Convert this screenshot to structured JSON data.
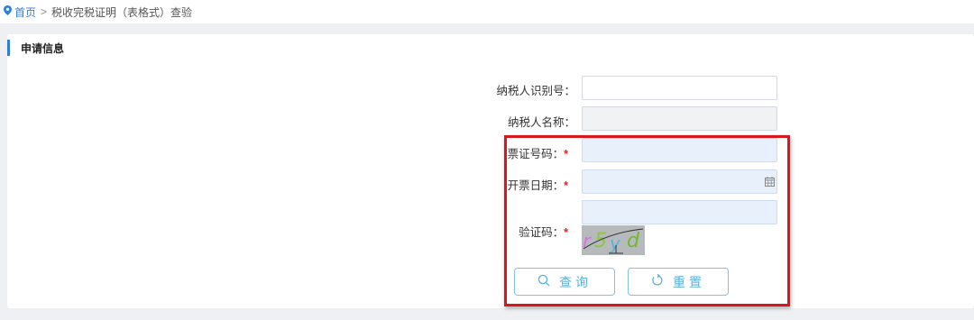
{
  "breadcrumb": {
    "home": "首页",
    "separator": ">",
    "current": "税收完税证明（表格式）查验"
  },
  "panel": {
    "title": "申请信息"
  },
  "form": {
    "taxpayer_id": {
      "label": "纳税人识别号：",
      "value": ""
    },
    "taxpayer_name": {
      "label": "纳税人名称：",
      "value": ""
    },
    "ticket_number": {
      "label": "票证号码：",
      "required_mark": "*",
      "value": ""
    },
    "issue_date": {
      "label": "开票日期：",
      "required_mark": "*",
      "value": "",
      "icon": "calendar-icon"
    },
    "captcha": {
      "label": "验证码：",
      "required_mark": "*",
      "value": "",
      "image_text": "r5yd"
    }
  },
  "buttons": {
    "query": {
      "label": "查询",
      "icon": "search-icon"
    },
    "reset": {
      "label": "重置",
      "icon": "refresh-icon"
    }
  },
  "colors": {
    "accent": "#2f7fd6",
    "button_text": "#5ab0de",
    "button_border": "#7cc4e8",
    "required": "#e02020",
    "highlight_box": "#d8161b"
  }
}
